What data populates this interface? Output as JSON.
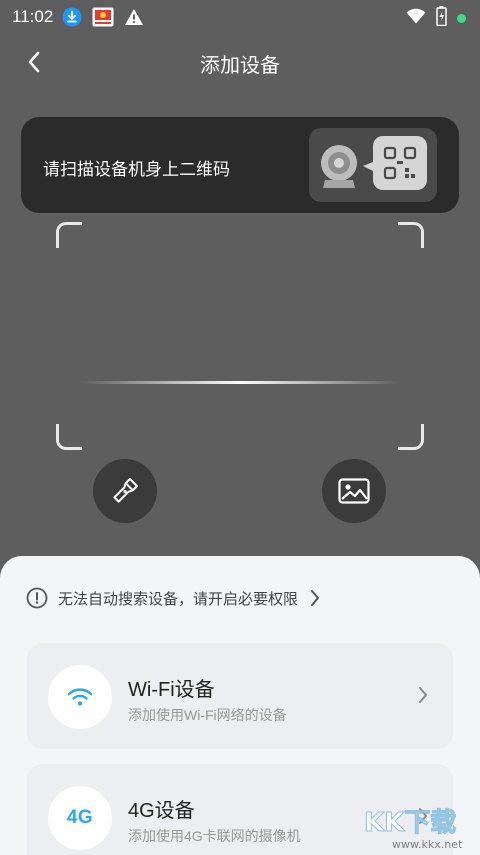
{
  "status_bar": {
    "time": "11:02",
    "icons": [
      "download-icon",
      "app-notification-icon",
      "warning-icon",
      "wifi-icon",
      "battery-charging-icon",
      "active-dot-icon"
    ]
  },
  "header": {
    "title": "添加设备",
    "back_icon": "back-arrow-icon"
  },
  "scan_hint": {
    "text": "请扫描设备机身上二维码",
    "illustration_icons": [
      "camera-icon",
      "qr-code-icon"
    ]
  },
  "scan_actions": {
    "flashlight_icon": "flashlight-icon",
    "album_icon": "image-icon"
  },
  "bottom_sheet": {
    "permission_notice": "无法自动搜索设备，请开启必要权限",
    "devices": [
      {
        "title": "Wi-Fi设备",
        "subtitle": "添加使用Wi-Fi网络的设备",
        "icon": "wifi-icon"
      },
      {
        "title": "4G设备",
        "subtitle": "添加使用4G卡联网的摄像机",
        "icon_text": "4G"
      }
    ]
  },
  "watermark": {
    "brand": "KK下载",
    "url": "www.kkx.net"
  },
  "colors": {
    "accent": "#29a8ee",
    "background": "#5e5e5e",
    "sheet": "#f4f5f7"
  }
}
